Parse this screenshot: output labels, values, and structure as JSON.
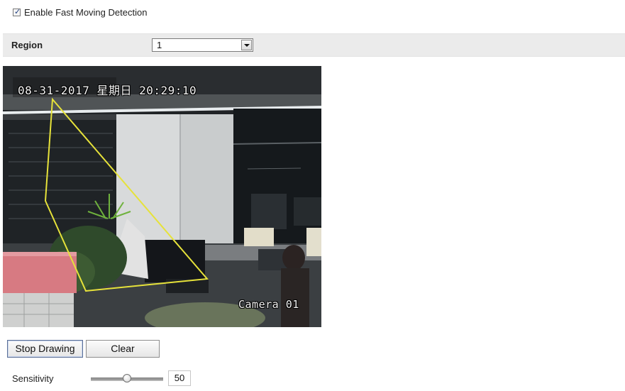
{
  "enable_detection": {
    "label": "Enable Fast Moving Detection",
    "checked": true
  },
  "region": {
    "label": "Region",
    "selected": "1"
  },
  "camera": {
    "osd_timestamp": "08-31-2017 星期日 20:29:10",
    "osd_camera_name": "Camera 01",
    "region_color": "#e6e23a"
  },
  "actions": {
    "stop_drawing_label": "Stop Drawing",
    "clear_label": "Clear"
  },
  "sensitivity": {
    "label": "Sensitivity",
    "value": "50",
    "min": 0,
    "max": 100
  }
}
